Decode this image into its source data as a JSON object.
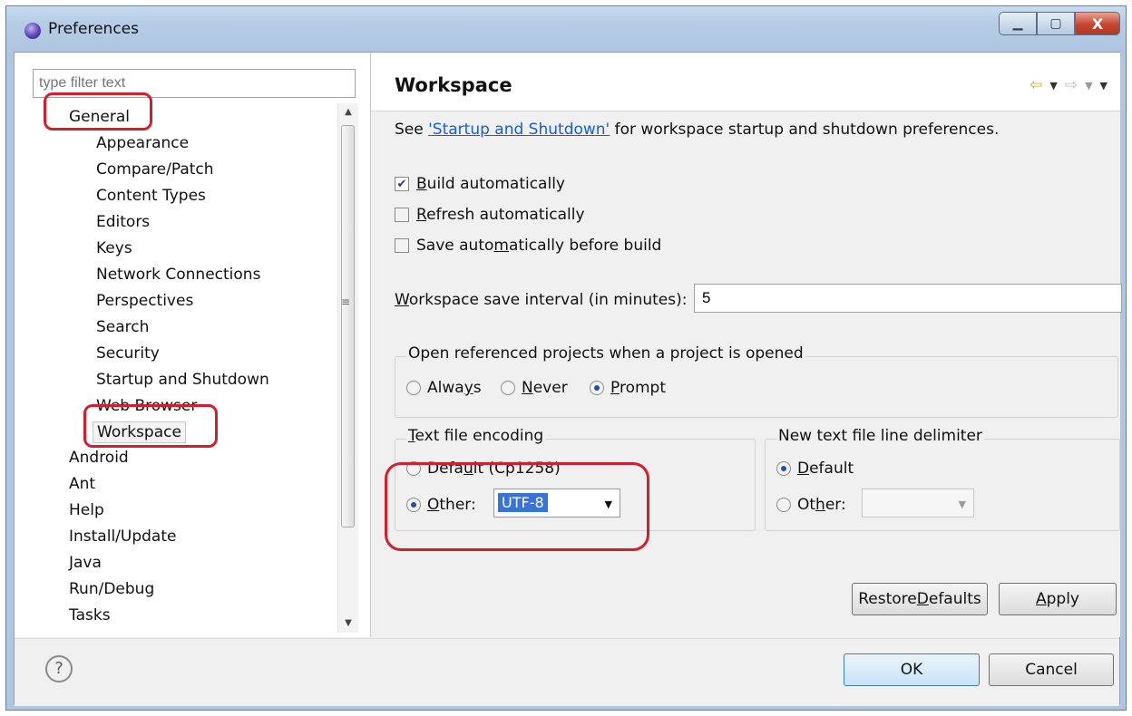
{
  "window": {
    "title": "Preferences",
    "buttons": {
      "minimize": "▁",
      "maximize": "▢",
      "close": "X"
    }
  },
  "filter": {
    "placeholder": "type filter text"
  },
  "tree": {
    "general": "General",
    "children": [
      "Appearance",
      "Compare/Patch",
      "Content Types",
      "Editors",
      "Keys",
      "Network Connections",
      "Perspectives",
      "Search",
      "Security",
      "Startup and Shutdown",
      "Web Browser",
      "Workspace"
    ],
    "roots": [
      "Android",
      "Ant",
      "Help",
      "Install/Update",
      "Java",
      "Run/Debug",
      "Tasks"
    ]
  },
  "page": {
    "title": "Workspace",
    "intro_prefix": "See ",
    "intro_link": "'Startup and Shutdown'",
    "intro_suffix": " for workspace startup and shutdown preferences.",
    "checks": [
      {
        "label_pre": "",
        "label_u": "B",
        "label_post": "uild automatically",
        "checked": true
      },
      {
        "label_pre": "",
        "label_u": "R",
        "label_post": "efresh automatically",
        "checked": false
      },
      {
        "label_pre": "Save auto",
        "label_u": "m",
        "label_post": "atically before build",
        "checked": false
      }
    ],
    "interval_label_u": "W",
    "interval_label_rest": "orkspace save interval (in minutes):",
    "interval_value": "5",
    "open_group": {
      "title": "Open referenced projects when a project is opened",
      "options": [
        {
          "pre": "Alwa",
          "u": "y",
          "post": "s",
          "selected": false
        },
        {
          "pre": "",
          "u": "N",
          "post": "ever",
          "selected": false
        },
        {
          "pre": "",
          "u": "P",
          "post": "rompt",
          "selected": true
        }
      ]
    },
    "encoding_group": {
      "title_u": "T",
      "title_rest": "ext file encoding",
      "default_pre": "Defa",
      "default_u": "u",
      "default_post": "lt (Cp1258)",
      "other_u": "O",
      "other_post": "ther:",
      "value": "UTF-8",
      "selected": "other"
    },
    "delimiter_group": {
      "title": "New text file line delimiter",
      "default_u": "D",
      "default_post": "efault",
      "other_pre": "Ot",
      "other_u": "h",
      "other_post": "er:",
      "selected": "default"
    },
    "restore_pre": "Restore ",
    "restore_u": "D",
    "restore_post": "efaults",
    "apply_u": "A",
    "apply_post": "pply"
  },
  "footer": {
    "help": "?",
    "ok": "OK",
    "cancel": "Cancel"
  },
  "colors": {
    "annotation": "#d31f2b",
    "link": "#1a5cd6",
    "accent": "#3a73d6"
  }
}
